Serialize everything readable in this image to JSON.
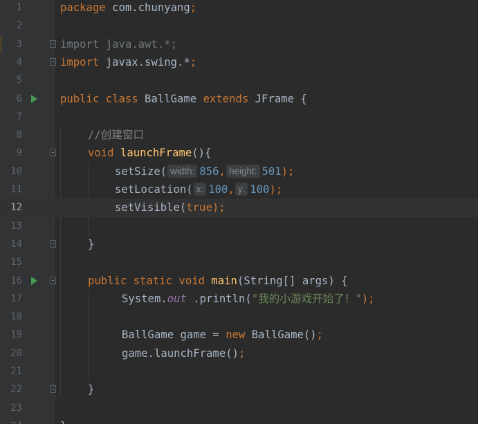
{
  "editor": {
    "current_line": 12,
    "lines": [
      {
        "n": "1"
      },
      {
        "n": "2"
      },
      {
        "n": "3"
      },
      {
        "n": "4"
      },
      {
        "n": "5"
      },
      {
        "n": "6"
      },
      {
        "n": "7"
      },
      {
        "n": "8"
      },
      {
        "n": "9"
      },
      {
        "n": "10"
      },
      {
        "n": "11"
      },
      {
        "n": "12"
      },
      {
        "n": "13"
      },
      {
        "n": "14"
      },
      {
        "n": "15"
      },
      {
        "n": "16"
      },
      {
        "n": "17"
      },
      {
        "n": "18"
      },
      {
        "n": "19"
      },
      {
        "n": "20"
      },
      {
        "n": "21"
      },
      {
        "n": "22"
      },
      {
        "n": "23"
      },
      {
        "n": "24"
      }
    ],
    "code": {
      "l1_kw": "package",
      "l1_name": " com.chunyang",
      "l1_semi": ";",
      "l3_kw": "import",
      "l3_rest": " java.awt.*;",
      "l4_kw": "import",
      "l4_rest": " javax.swing.*",
      "l4_semi": ";",
      "l6_kw": "public class",
      "l6_name": " BallGame ",
      "l6_kw2": "extends",
      "l6_rest": " JFrame {",
      "l8_comment": "//创建窗口",
      "l9_kw": "void",
      "l9_fn": " launchFrame",
      "l9_rest": "(){",
      "l10_call": "setSize(",
      "l10_hint1": "width:",
      "l10_val1": "856",
      "l10_comma": ",",
      "l10_hint2": "height:",
      "l10_val2": "501",
      "l10_close": ");",
      "l11_call": "setLocation(",
      "l11_hint1": "x:",
      "l11_val1": "100",
      "l11_comma": ",",
      "l11_hint2": "y:",
      "l11_val2": "100",
      "l11_close": ");",
      "l12_call": "setVisible(",
      "l12_val": "true",
      "l12_close": ");",
      "l14_brace": "}",
      "l16_kw": "public static void",
      "l16_fn": " main",
      "l16_rest": "(String[] args) {",
      "l17_obj": "System.",
      "l17_field": "out",
      "l17_call": " .println(",
      "l17_str": "\"我的小游戏开始了！\"",
      "l17_close": ");",
      "l19_decl": "BallGame game = ",
      "l19_kw": "new",
      "l19_rest": " BallGame()",
      "l19_semi": ";",
      "l20_call": "game.launchFrame()",
      "l20_semi": ";",
      "l22_brace": "}",
      "l24_brace": "}"
    }
  }
}
